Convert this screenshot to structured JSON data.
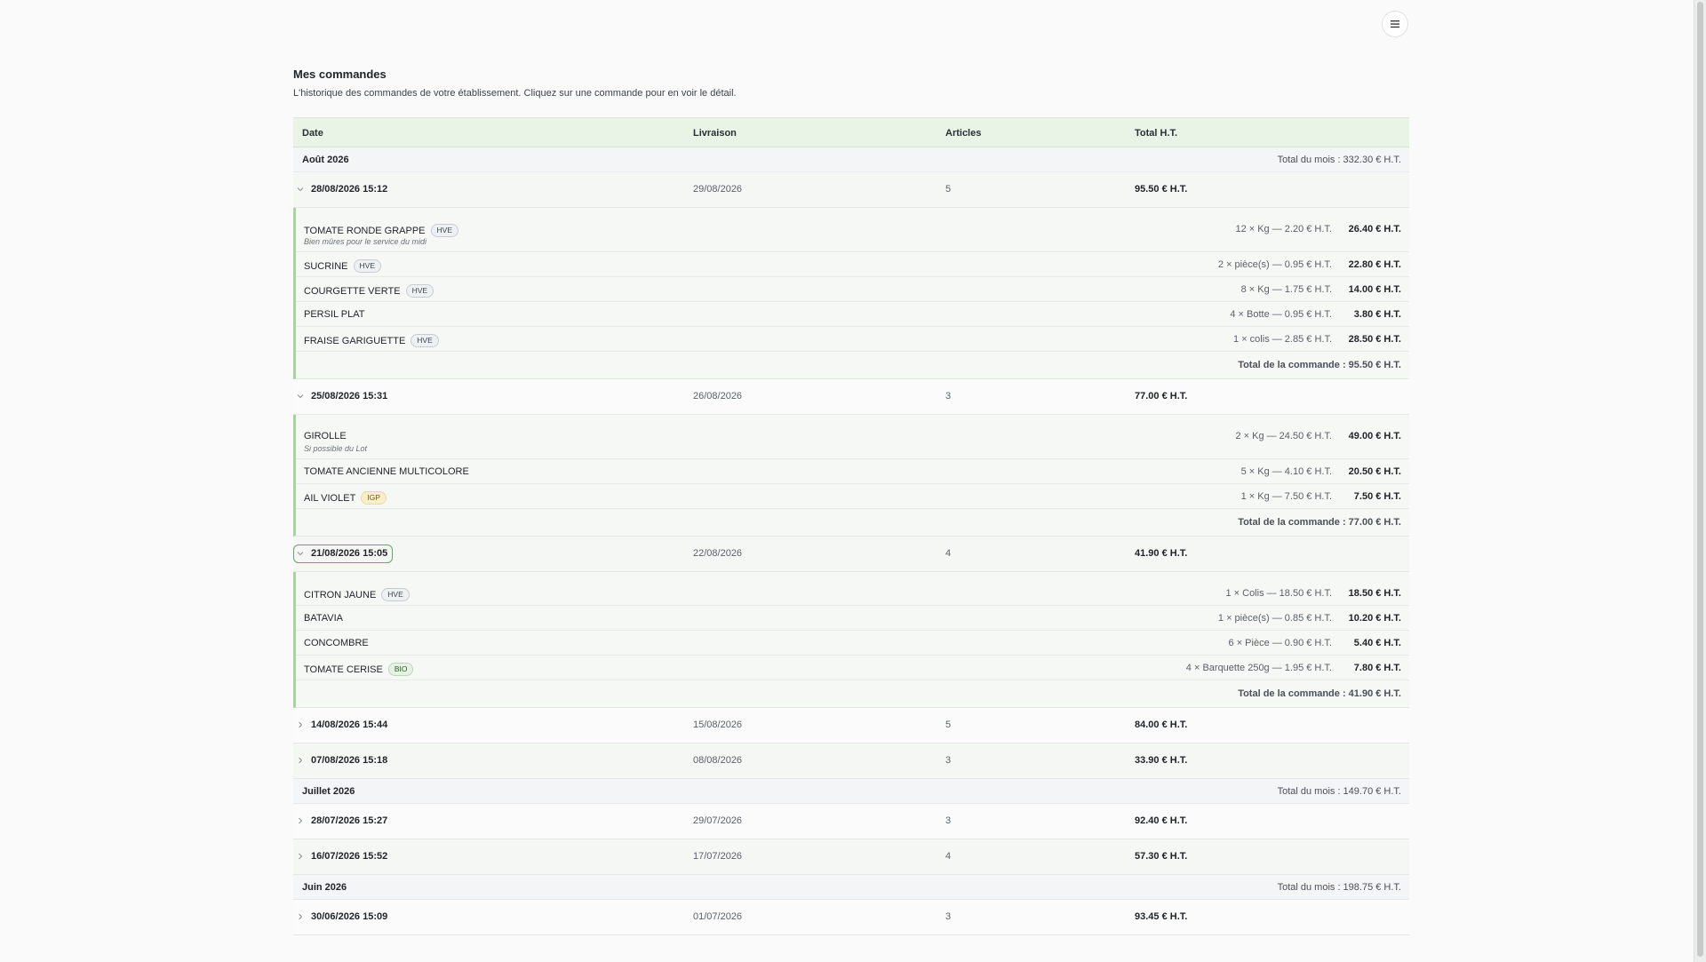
{
  "page": {
    "title": "Mes commandes",
    "subtitle": "L'historique des commandes de votre établissement. Cliquez sur une commande pour en voir le détail."
  },
  "table": {
    "headers": {
      "date": "Date",
      "livraison": "Livraison",
      "articles": "Articles",
      "total": "Total H.T."
    },
    "months": [
      {
        "label": "Août 2026",
        "total": "Total du mois : 332.30 € H.T.",
        "orders": [
          {
            "date": "28/08/2026 15:12",
            "livraison": "29/08/2026",
            "articles": "5",
            "total": "95.50 € H.T.",
            "expanded": true,
            "items": [
              {
                "name": "TOMATE RONDE GRAPPE",
                "badge": "HVE",
                "note": "Bien mûres pour le service du midi",
                "qty": "12 × Kg — 2.20 € H.T.",
                "price": "26.40 € H.T."
              },
              {
                "name": "SUCRINE",
                "badge": "HVE",
                "note": "",
                "qty": "2 × pièce(s) — 0.95 € H.T.",
                "price": "22.80 € H.T."
              },
              {
                "name": "COURGETTE VERTE",
                "badge": "HVE",
                "note": "",
                "qty": "8 × Kg — 1.75 € H.T.",
                "price": "14.00 € H.T."
              },
              {
                "name": "PERSIL PLAT",
                "badge": "",
                "note": "",
                "qty": "4 × Botte — 0.95 € H.T.",
                "price": "3.80 € H.T."
              },
              {
                "name": "FRAISE GARIGUETTE",
                "badge": "HVE",
                "note": "",
                "qty": "1 × colis — 2.85 € H.T.",
                "price": "28.50 € H.T."
              }
            ],
            "order_total": "Total de la commande : 95.50 € H.T."
          },
          {
            "date": "25/08/2026 15:31",
            "livraison": "26/08/2026",
            "articles": "3",
            "total": "77.00 € H.T.",
            "expanded": true,
            "items": [
              {
                "name": "GIROLLE",
                "badge": "",
                "note": "Si possible du Lot",
                "qty": "2 × Kg — 24.50 € H.T.",
                "price": "49.00 € H.T."
              },
              {
                "name": "TOMATE ANCIENNE MULTICOLORE",
                "badge": "",
                "note": "",
                "qty": "5 × Kg — 4.10 € H.T.",
                "price": "20.50 € H.T."
              },
              {
                "name": "AIL VIOLET",
                "badge": "IGP",
                "note": "",
                "qty": "1 × Kg — 7.50 € H.T.",
                "price": "7.50 € H.T."
              }
            ],
            "order_total": "Total de la commande : 77.00 € H.T."
          },
          {
            "date": "21/08/2026 15:05",
            "livraison": "22/08/2026",
            "articles": "4",
            "total": "41.90 € H.T.",
            "expanded": true,
            "items": [
              {
                "name": "CITRON JAUNE",
                "badge": "HVE",
                "note": "",
                "qty": "1 × Colis — 18.50 € H.T.",
                "price": "18.50 € H.T."
              },
              {
                "name": "BATAVIA",
                "badge": "",
                "note": "",
                "qty": "1 × pièce(s) — 0.85 € H.T.",
                "price": "10.20 € H.T."
              },
              {
                "name": "CONCOMBRE",
                "badge": "",
                "note": "",
                "qty": "6 × Pièce — 0.90 € H.T.",
                "price": "5.40 € H.T."
              },
              {
                "name": "TOMATE CERISE",
                "badge": "BIO",
                "note": "",
                "qty": "4 × Barquette 250g — 1.95 € H.T.",
                "price": "7.80 € H.T."
              }
            ],
            "order_total": "Total de la commande : 41.90 € H.T."
          },
          {
            "date": "14/08/2026 15:44",
            "livraison": "15/08/2026",
            "articles": "5",
            "total": "84.00 € H.T.",
            "expanded": false
          },
          {
            "date": "07/08/2026 15:18",
            "livraison": "08/08/2026",
            "articles": "3",
            "total": "33.90 € H.T.",
            "expanded": false
          }
        ]
      },
      {
        "label": "Juillet 2026",
        "total": "Total du mois : 149.70 € H.T.",
        "orders": [
          {
            "date": "28/07/2026 15:27",
            "livraison": "29/07/2026",
            "articles": "3",
            "total": "92.40 € H.T.",
            "expanded": false
          },
          {
            "date": "16/07/2026 15:52",
            "livraison": "17/07/2026",
            "articles": "4",
            "total": "57.30 € H.T.",
            "expanded": false
          }
        ]
      },
      {
        "label": "Juin 2026",
        "total": "Total du mois : 198.75 € H.T.",
        "orders": [
          {
            "date": "30/06/2026 15:09",
            "livraison": "01/07/2026",
            "articles": "3",
            "total": "93.45 € H.T.",
            "expanded": false
          }
        ]
      }
    ]
  },
  "icons": {
    "menu": "menu-icon",
    "expanded": "chevron-down-icon",
    "collapsed": "chevron-right-icon"
  }
}
